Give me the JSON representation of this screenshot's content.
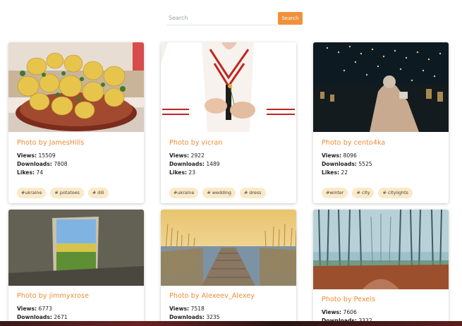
{
  "search": {
    "placeholder": "Search",
    "button_label": "Search"
  },
  "cards": [
    {
      "title": "Photo by JamesHills",
      "views_label": "Views:",
      "views": "15509",
      "downloads_label": "Downloads:",
      "downloads": "7808",
      "likes_label": "Likes:",
      "likes": "74",
      "tags": [
        "#ukraine",
        "# potatoes",
        "# dill"
      ],
      "image": "potatoes-dish"
    },
    {
      "title": "Photo by vicran",
      "views_label": "Views:",
      "views": "2922",
      "downloads_label": "Downloads:",
      "downloads": "1489",
      "likes_label": "Likes:",
      "likes": "23",
      "tags": [
        "#ukraine",
        "# wedding",
        "# dress"
      ],
      "image": "embroidered-dress"
    },
    {
      "title": "Photo by cento4ka",
      "views_label": "Views:",
      "views": "8096",
      "downloads_label": "Downloads:",
      "downloads": "5525",
      "likes_label": "Likes:",
      "likes": "22",
      "tags": [
        "#winter",
        "# city",
        "# citylights"
      ],
      "image": "city-lights"
    },
    {
      "title": "Photo by jimmyxrose",
      "views_label": "Views:",
      "views": "6773",
      "downloads_label": "Downloads:",
      "downloads": "2671",
      "image": "window-field"
    },
    {
      "title": "Photo by Alexeev_Alexey",
      "views_label": "Views:",
      "views": "7518",
      "downloads_label": "Downloads:",
      "downloads": "3235",
      "image": "lake-pier"
    },
    {
      "title": "Photo by Pexels",
      "views_label": "Views:",
      "views": "7606",
      "downloads_label": "Downloads:",
      "downloads": "3332",
      "image": "misty-forest"
    }
  ],
  "colors": {
    "accent": "#f0913a",
    "title": "#ee8a33",
    "tag_bg": "#fbe9c7"
  }
}
